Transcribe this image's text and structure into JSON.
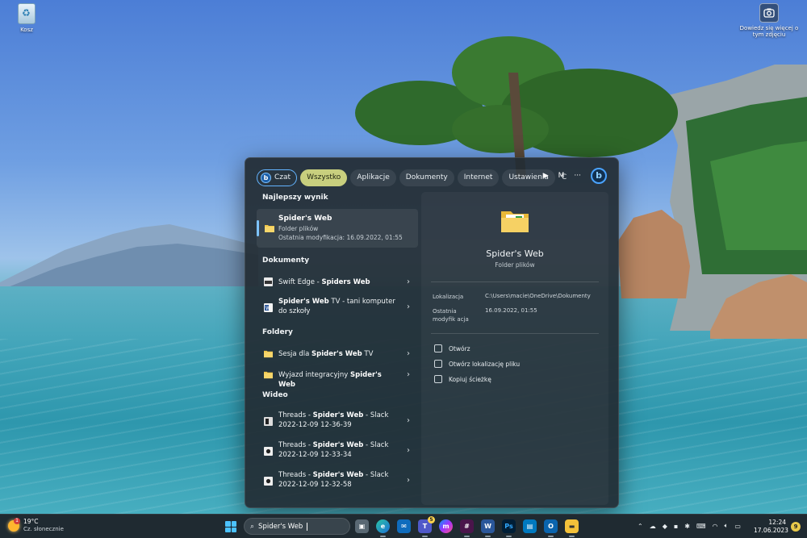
{
  "desktop": {
    "recycle_label": "Kosz",
    "camera_label": "Dowiedz się więcej o tym zdjęciu"
  },
  "search_panel": {
    "tabs": [
      {
        "label": "Czat"
      },
      {
        "label": "Wszystko"
      },
      {
        "label": "Aplikacje"
      },
      {
        "label": "Dokumenty"
      },
      {
        "label": "Internet"
      },
      {
        "label": "Ustawienia"
      },
      {
        "label": "C"
      }
    ],
    "tab_m": "M",
    "tab_more": "···",
    "best_section": "Najlepszy wynik",
    "best": {
      "title": "Spider's Web",
      "type": "Folder plików",
      "modified": "Ostatnia modyfikacja: 16.09.2022, 01:55"
    },
    "documents_section": "Dokumenty",
    "documents": [
      {
        "prefix": "Swift Edge - ",
        "highlight": "Spiders Web",
        "suffix": ""
      },
      {
        "prefix": "",
        "highlight": "Spider's Web",
        "suffix": " TV - tani komputer do szkoły"
      }
    ],
    "folders_section": "Foldery",
    "folders": [
      {
        "prefix": "Sesja dla ",
        "highlight": "Spider's Web",
        "suffix": " TV"
      },
      {
        "prefix": "Wyjazd integracyjny ",
        "highlight": "Spider's Web",
        "suffix": ""
      }
    ],
    "video_section": "Wideo",
    "videos": [
      {
        "prefix": "Threads - ",
        "highlight": "Spider's Web",
        "suffix": " - Slack",
        "line2": "2022-12-09 12-36-39"
      },
      {
        "prefix": "Threads - ",
        "highlight": "Spider's Web",
        "suffix": " - Slack",
        "line2": "2022-12-09 12-33-34"
      },
      {
        "prefix": "Threads - ",
        "highlight": "Spider's Web",
        "suffix": " - Slack",
        "line2": "2022-12-09 12-32-58"
      }
    ],
    "detail": {
      "title": "Spider's Web",
      "subtitle": "Folder plików",
      "location_label": "Lokalizacja",
      "location_value": "C:\\Users\\macie\\OneDrive\\Dokumenty",
      "modified_label": "Ostatnia modyfik acja",
      "modified_value": "16.09.2022, 01:55",
      "actions": [
        "Otwórz",
        "Otwórz lokalizację pliku",
        "Kopiuj ścieżkę"
      ]
    }
  },
  "taskbar": {
    "weather_temp": "19°C",
    "weather_desc": "Cz. słonecznie",
    "weather_badge": "1",
    "search_value": "Spider's Web",
    "teams_badge": "5",
    "time": "12:24",
    "date": "17.06.2023",
    "notifications": "9"
  },
  "colors": {
    "accent": "#63b4ff",
    "active_tab": "#c8cf7e",
    "panel_bg": "#222c34"
  }
}
